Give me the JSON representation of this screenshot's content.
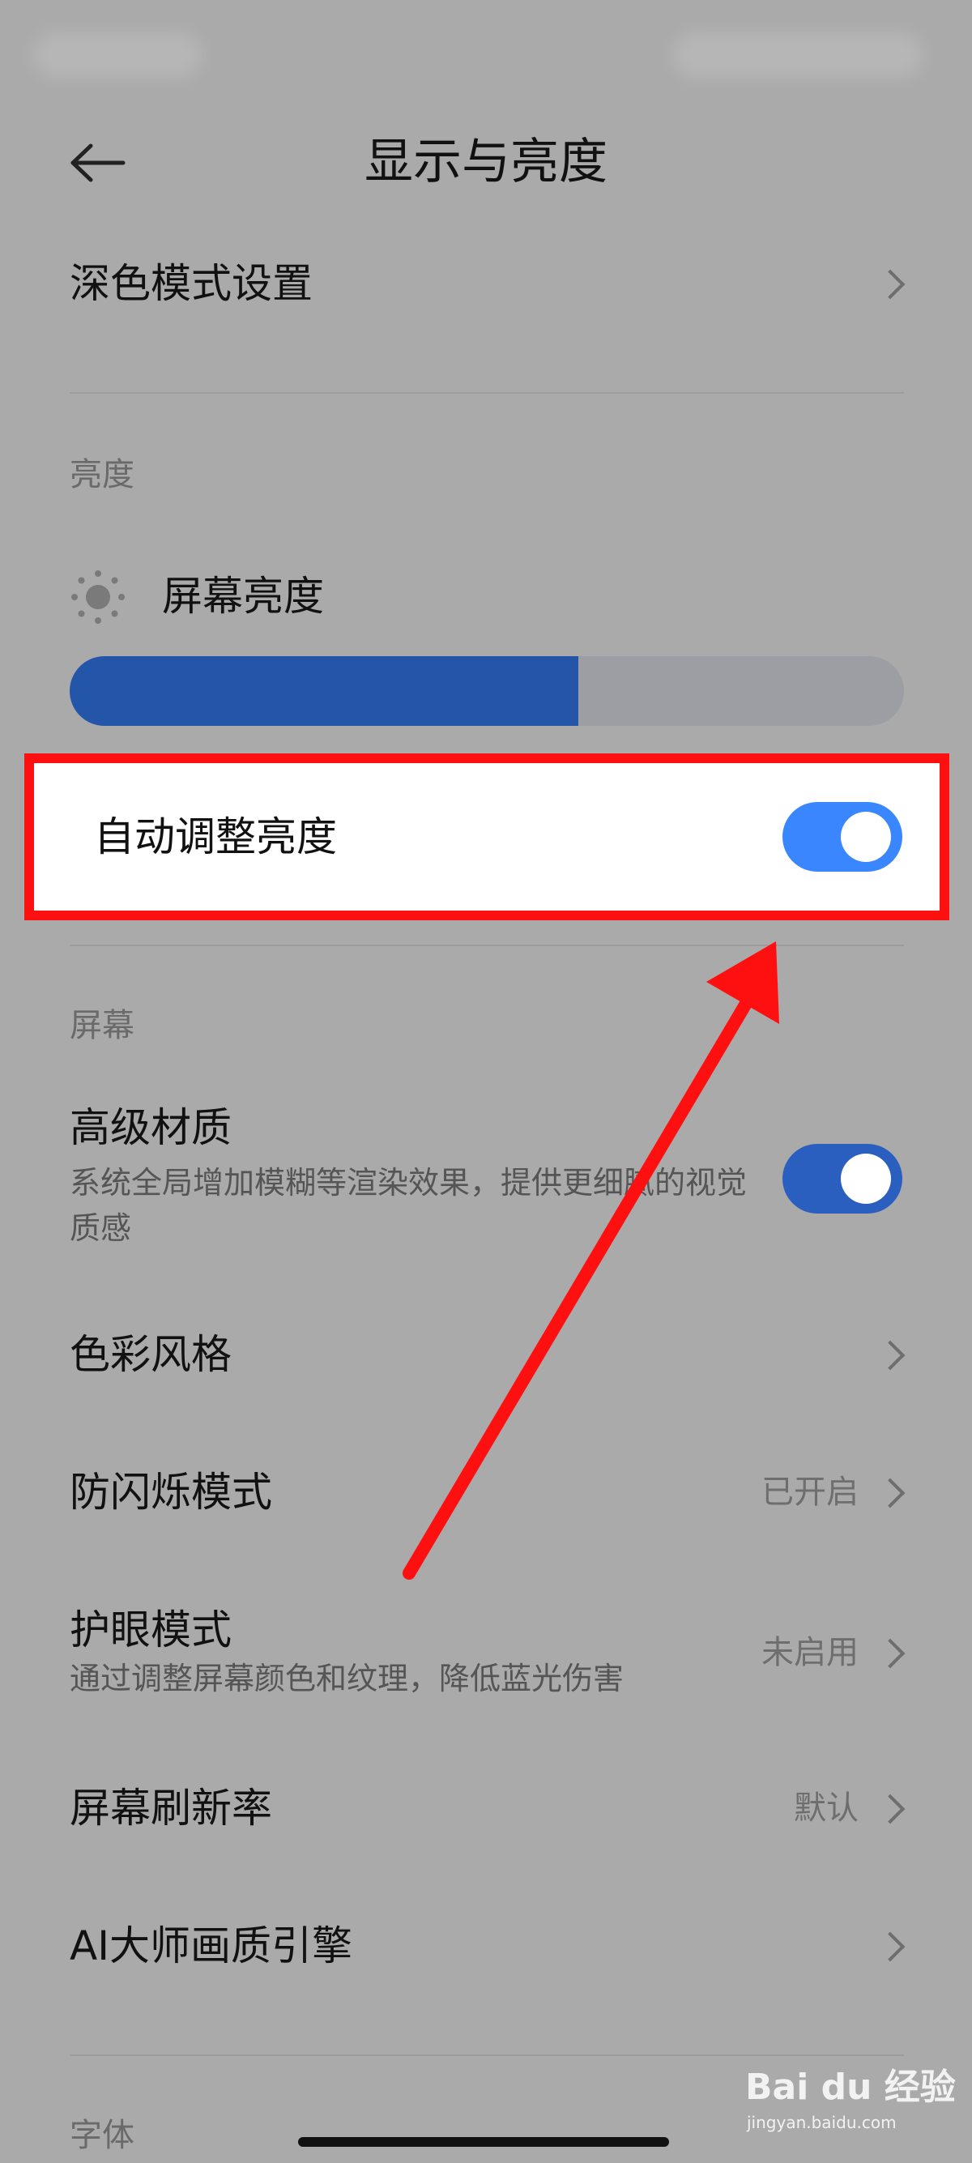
{
  "header": {
    "title": "显示与亮度"
  },
  "dark_mode_row": {
    "label": "深色模式设置"
  },
  "brightness": {
    "section_title": "亮度",
    "label": "屏幕亮度",
    "level_fraction": 0.61,
    "auto_label": "自动调整亮度",
    "auto_enabled": true
  },
  "screen": {
    "section_title": "屏幕",
    "rows": [
      {
        "label": "高级材质",
        "subtitle": "系统全局增加模糊等渲染效果，提供更细腻的视觉质感",
        "control": "toggle-on"
      },
      {
        "label": "色彩风格",
        "control": "chevron"
      },
      {
        "label": "防闪烁模式",
        "value": "已开启",
        "control": "chevron"
      },
      {
        "label": "护眼模式",
        "subtitle": "通过调整屏幕颜色和纹理，降低蓝光伤害",
        "value": "未启用",
        "control": "chevron"
      },
      {
        "label": "屏幕刷新率",
        "value": "默认",
        "control": "chevron"
      },
      {
        "label": "AI大师画质引擎",
        "control": "chevron"
      }
    ]
  },
  "font": {
    "section_title": "字体"
  },
  "watermark": {
    "text": "Bai du 经验",
    "sub": "jingyan.baidu.com"
  },
  "colors": {
    "background": "#aaaaaa",
    "toggle_active": "#3a86ff",
    "toggle_dim": "#2a5fbf",
    "slider_fill": "#2356a8",
    "highlight_border": "#ff1010",
    "arrow": "#ff1010"
  }
}
